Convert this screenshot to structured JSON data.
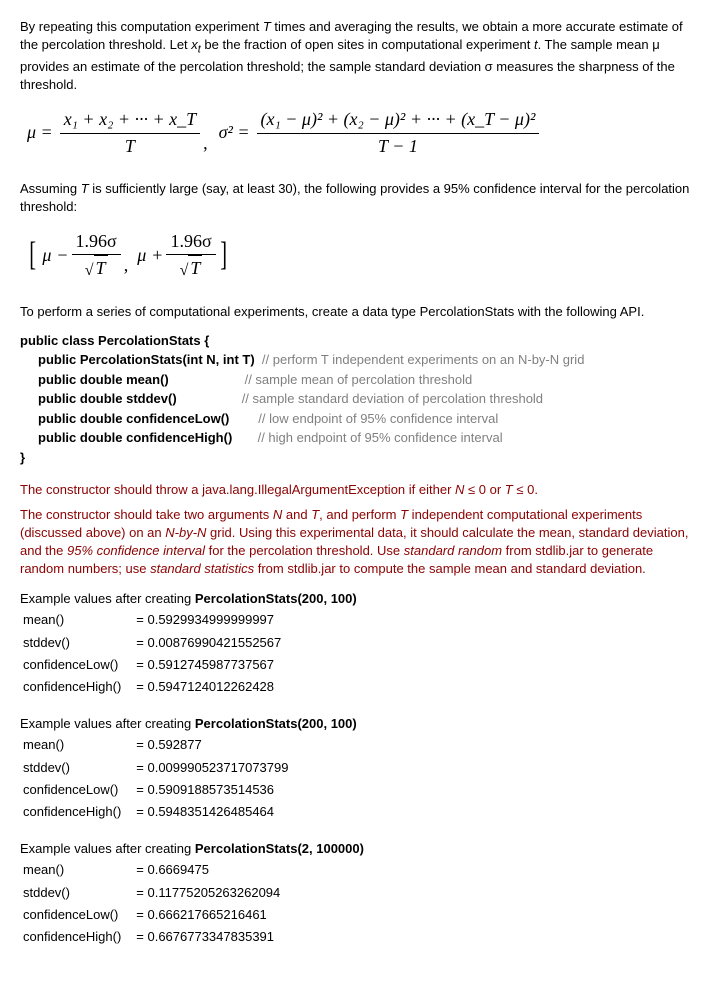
{
  "intro_p1": "By repeating this computation experiment T times and averaging the results, we obtain a more accurate estimate of the percolation threshold. Let x_t be the fraction of open sites in computational experiment t. The sample mean μ provides an estimate of the percolation threshold; the sample standard deviation σ measures the sharpness of the threshold.",
  "formula1": {
    "mu_eq": "μ =",
    "mean_num": "x₁ + x₂ + ··· + x_T",
    "mean_den": "T",
    "comma": ",",
    "sigma_eq": "σ² =",
    "var_num": "(x₁ − μ)² + (x₂ − μ)² + ··· + (x_T − μ)²",
    "var_den": "T − 1"
  },
  "intro_p2": "Assuming T is sufficiently large (say, at least 30), the following provides a 95% confidence interval for the percolation threshold:",
  "formula2": {
    "mu": "μ",
    "minus": "−",
    "plus": "+",
    "coef_sigma": "1.96σ",
    "sqrtT": "T",
    "comma": ","
  },
  "intro_p3": "To perform a series of computational experiments, create a data type PercolationStats with the following API.",
  "api": {
    "class_decl": "public class PercolationStats {",
    "ctor": "public PercolationStats(int N, int T)",
    "ctor_c": "// perform T independent experiments on an N-by-N grid",
    "mean": "public double mean()",
    "mean_c": "// sample mean of percolation threshold",
    "stddev": "public double stddev()",
    "stddev_c": "// sample standard deviation of percolation threshold",
    "cl": "public double confidenceLow()",
    "cl_c": "// low  endpoint of 95% confidence interval",
    "ch": "public double confidenceHigh()",
    "ch_c": "// high endpoint of 95% confidence interval",
    "close": "}"
  },
  "red_p1": "The constructor should throw a java.lang.IllegalArgumentException if either N ≤ 0 or T ≤ 0.",
  "red_p2a": "The constructor should take two arguments ",
  "red_N": "N",
  "red_and": " and ",
  "red_T": "T",
  "red_p2b": ", and perform ",
  "red_Ti": "T",
  "red_p2c": " independent computational experiments (discussed above) on an ",
  "red_NbyN": "N-by-N",
  "red_p2d": " grid. Using this experimental data, it should calculate the mean, standard deviation, and the ",
  "red_ci": "95% confidence interval",
  "red_p2e": " for the percolation threshold. Use ",
  "red_sr": "standard random",
  "red_p2f": " from stdlib.jar to generate random numbers; use ",
  "red_ss": "standard statistics",
  "red_p2g": " from stdlib.jar to compute the sample mean and standard deviation.",
  "ex1": {
    "title_a": "Example values after creating ",
    "title_b": "PercolationStats(200, 100)",
    "rows": [
      {
        "k": "mean()",
        "v": "= 0.5929934999999997"
      },
      {
        "k": "stddev()",
        "v": "= 0.00876990421552567"
      },
      {
        "k": "confidenceLow()",
        "v": "= 0.5912745987737567"
      },
      {
        "k": "confidenceHigh()",
        "v": "= 0.5947124012262428"
      }
    ]
  },
  "ex2": {
    "title_a": "Example values after creating ",
    "title_b": "PercolationStats(200, 100)",
    "rows": [
      {
        "k": "mean()",
        "v": "= 0.592877"
      },
      {
        "k": "stddev()",
        "v": "= 0.009990523717073799"
      },
      {
        "k": "confidenceLow()",
        "v": "= 0.5909188573514536"
      },
      {
        "k": "confidenceHigh()",
        "v": "= 0.5948351426485464"
      }
    ]
  },
  "ex3": {
    "title_a": "Example values after creating ",
    "title_b": "PercolationStats(2, 100000)",
    "rows": [
      {
        "k": "mean()",
        "v": "= 0.6669475"
      },
      {
        "k": "stddev()",
        "v": "= 0.11775205263262094"
      },
      {
        "k": "confidenceLow()",
        "v": "= 0.666217665216461"
      },
      {
        "k": "confidenceHigh()",
        "v": "= 0.6676773347835391"
      }
    ]
  }
}
